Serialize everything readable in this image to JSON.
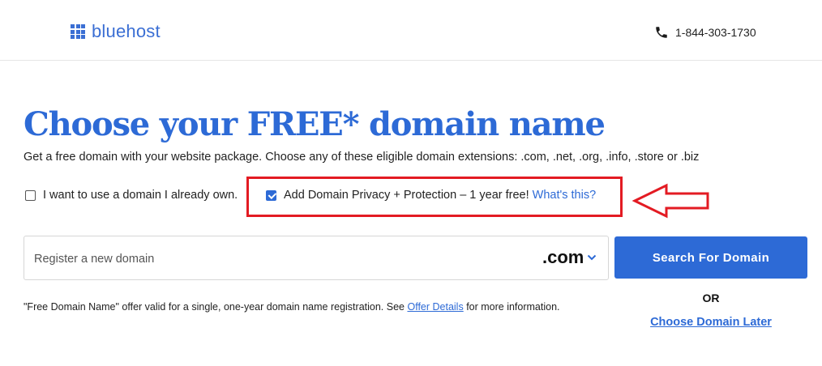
{
  "header": {
    "brand": "bluehost",
    "phone": "1-844-303-1730"
  },
  "main": {
    "title": "Choose your FREE* domain name",
    "subtitle": "Get a free domain with your website package. Choose any of these eligible domain extensions: .com, .net, .org, .info, .store or .biz",
    "options": {
      "existing_domain_label": "I want to use a domain I already own.",
      "existing_domain_checked": false,
      "privacy_label": "Add Domain Privacy + Protection – 1 year free!",
      "privacy_checked": true,
      "whats_this": "What's this?"
    },
    "search": {
      "placeholder": "Register a new domain",
      "value": "",
      "tld": ".com",
      "button_label": "Search For Domain"
    },
    "or_text": "OR",
    "choose_later": "Choose Domain Later",
    "disclaimer": {
      "before": "\"Free Domain Name\" offer valid for a single, one-year domain name registration. See ",
      "link": "Offer Details",
      "after": " for more information."
    }
  },
  "colors": {
    "brand_blue": "#2d6ad6",
    "annotation_red": "#e31b23"
  },
  "icons": {
    "logo": "grid-logo-icon",
    "phone": "phone-icon",
    "dropdown": "chevron-down-icon",
    "annotation": "arrow-left-icon"
  }
}
